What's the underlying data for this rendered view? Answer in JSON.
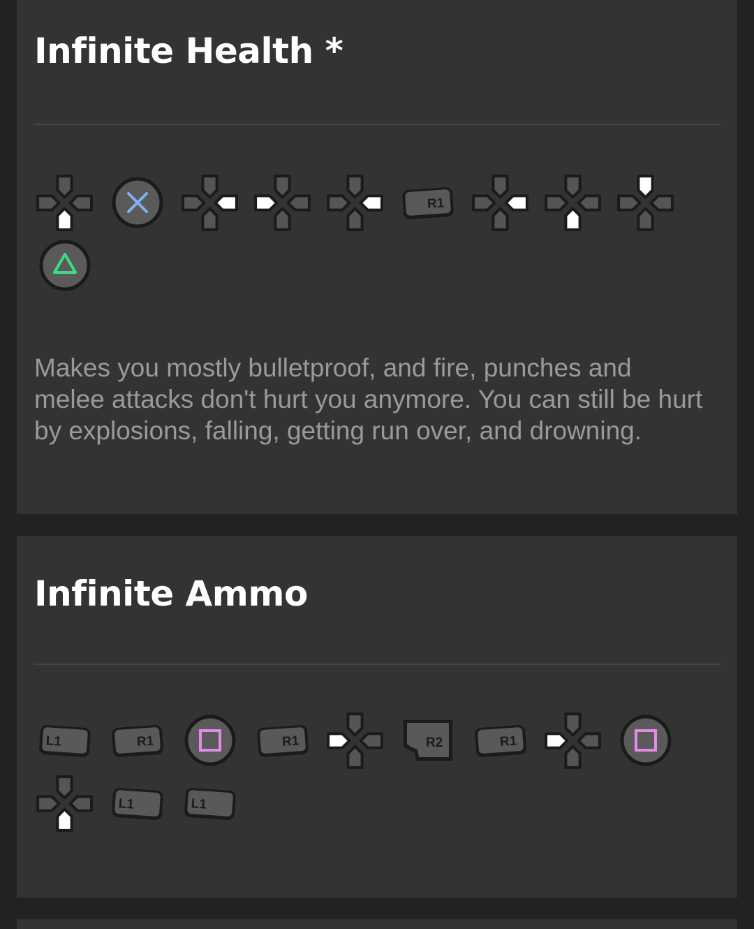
{
  "colors": {
    "background": "#222222",
    "card": "#333333",
    "title": "#ffffff",
    "description": "#9a9a9a",
    "divider": "#444444",
    "cross": "#7fb2f0",
    "triangle": "#3ddc84",
    "square": "#e38be6"
  },
  "cheats": [
    {
      "title": "Infinite Health *",
      "buttons": [
        {
          "type": "dpad",
          "dir": "down",
          "icon": "dpad-down-icon"
        },
        {
          "type": "face",
          "symbol": "cross",
          "icon": "cross-button-icon"
        },
        {
          "type": "dpad",
          "dir": "right",
          "icon": "dpad-right-icon"
        },
        {
          "type": "dpad",
          "dir": "left",
          "icon": "dpad-left-icon"
        },
        {
          "type": "dpad",
          "dir": "right",
          "icon": "dpad-right-icon"
        },
        {
          "type": "shoulder",
          "label": "R1",
          "icon": "r1-button-icon"
        },
        {
          "type": "dpad",
          "dir": "right",
          "icon": "dpad-right-icon"
        },
        {
          "type": "dpad",
          "dir": "down",
          "icon": "dpad-down-icon"
        },
        {
          "type": "dpad",
          "dir": "up",
          "icon": "dpad-up-icon"
        },
        {
          "type": "face",
          "symbol": "triangle",
          "icon": "triangle-button-icon"
        }
      ],
      "description": "Makes you mostly bulletproof, and fire, punches and melee attacks don't hurt you anymore. You can still be hurt by explosions, falling, getting run over, and drowning."
    },
    {
      "title": "Infinite Ammo",
      "buttons": [
        {
          "type": "shoulder",
          "label": "L1",
          "icon": "l1-button-icon"
        },
        {
          "type": "shoulder",
          "label": "R1",
          "icon": "r1-button-icon"
        },
        {
          "type": "face",
          "symbol": "square",
          "icon": "square-button-icon"
        },
        {
          "type": "shoulder",
          "label": "R1",
          "icon": "r1-button-icon"
        },
        {
          "type": "dpad",
          "dir": "left",
          "icon": "dpad-left-icon"
        },
        {
          "type": "trigger",
          "label": "R2",
          "icon": "r2-button-icon"
        },
        {
          "type": "shoulder",
          "label": "R1",
          "icon": "r1-button-icon"
        },
        {
          "type": "dpad",
          "dir": "left",
          "icon": "dpad-left-icon"
        },
        {
          "type": "face",
          "symbol": "square",
          "icon": "square-button-icon"
        },
        {
          "type": "dpad",
          "dir": "down",
          "icon": "dpad-down-icon"
        },
        {
          "type": "shoulder",
          "label": "L1",
          "icon": "l1-button-icon"
        },
        {
          "type": "shoulder",
          "label": "L1",
          "icon": "l1-button-icon"
        }
      ]
    }
  ]
}
